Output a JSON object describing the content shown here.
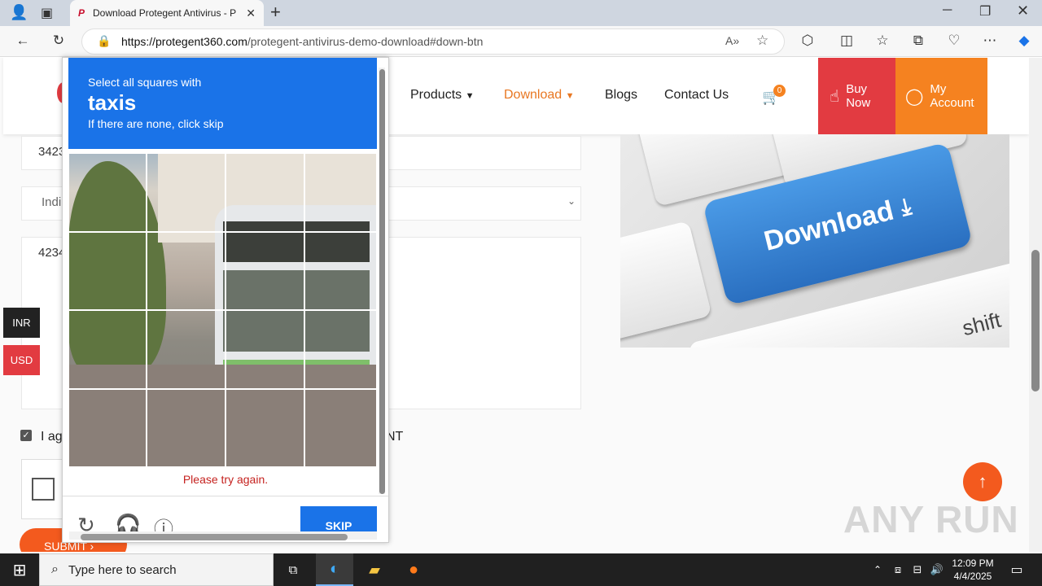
{
  "browser": {
    "tab_title": "Download Protegent Antivirus - P",
    "tab_favicon_text": "P",
    "url_host": "https://protegent360.com",
    "url_path": "/protegent-antivirus-demo-download#down-btn"
  },
  "site_nav": {
    "items": [
      {
        "label": "Products",
        "active": false
      },
      {
        "label": "Download",
        "active": true
      },
      {
        "label": "Blogs",
        "active": false
      },
      {
        "label": "Contact Us",
        "active": false
      }
    ],
    "cart_count": "0",
    "buy_now_label_1": "Buy",
    "buy_now_label_2": "Now",
    "my_account_label_1": "My",
    "my_account_label_2": "Account",
    "accent_color": "#e87722"
  },
  "form": {
    "phone_value": "3423",
    "country_value": "Indi",
    "message_value": "4234",
    "agree_prefix": "I ag",
    "agree_suffix": "NT",
    "submit_label": "SUBMIT ›"
  },
  "currency": {
    "inr": "INR",
    "usd": "USD"
  },
  "hero_image": {
    "key_label": "Download",
    "shift_label": "shift"
  },
  "captcha": {
    "instruction_line1": "Select all squares with",
    "target": "taxis",
    "instruction_line3": "If there are none, click skip",
    "error": "Please try again.",
    "skip_label": "SKIP",
    "header_color": "#1a73e8",
    "icons": [
      "reload-icon",
      "audio-icon",
      "info-icon"
    ]
  },
  "watermark": "ANY RUN",
  "taskbar": {
    "search_placeholder": "Type here to search",
    "time": "12:09 PM",
    "date": "4/4/2025"
  }
}
